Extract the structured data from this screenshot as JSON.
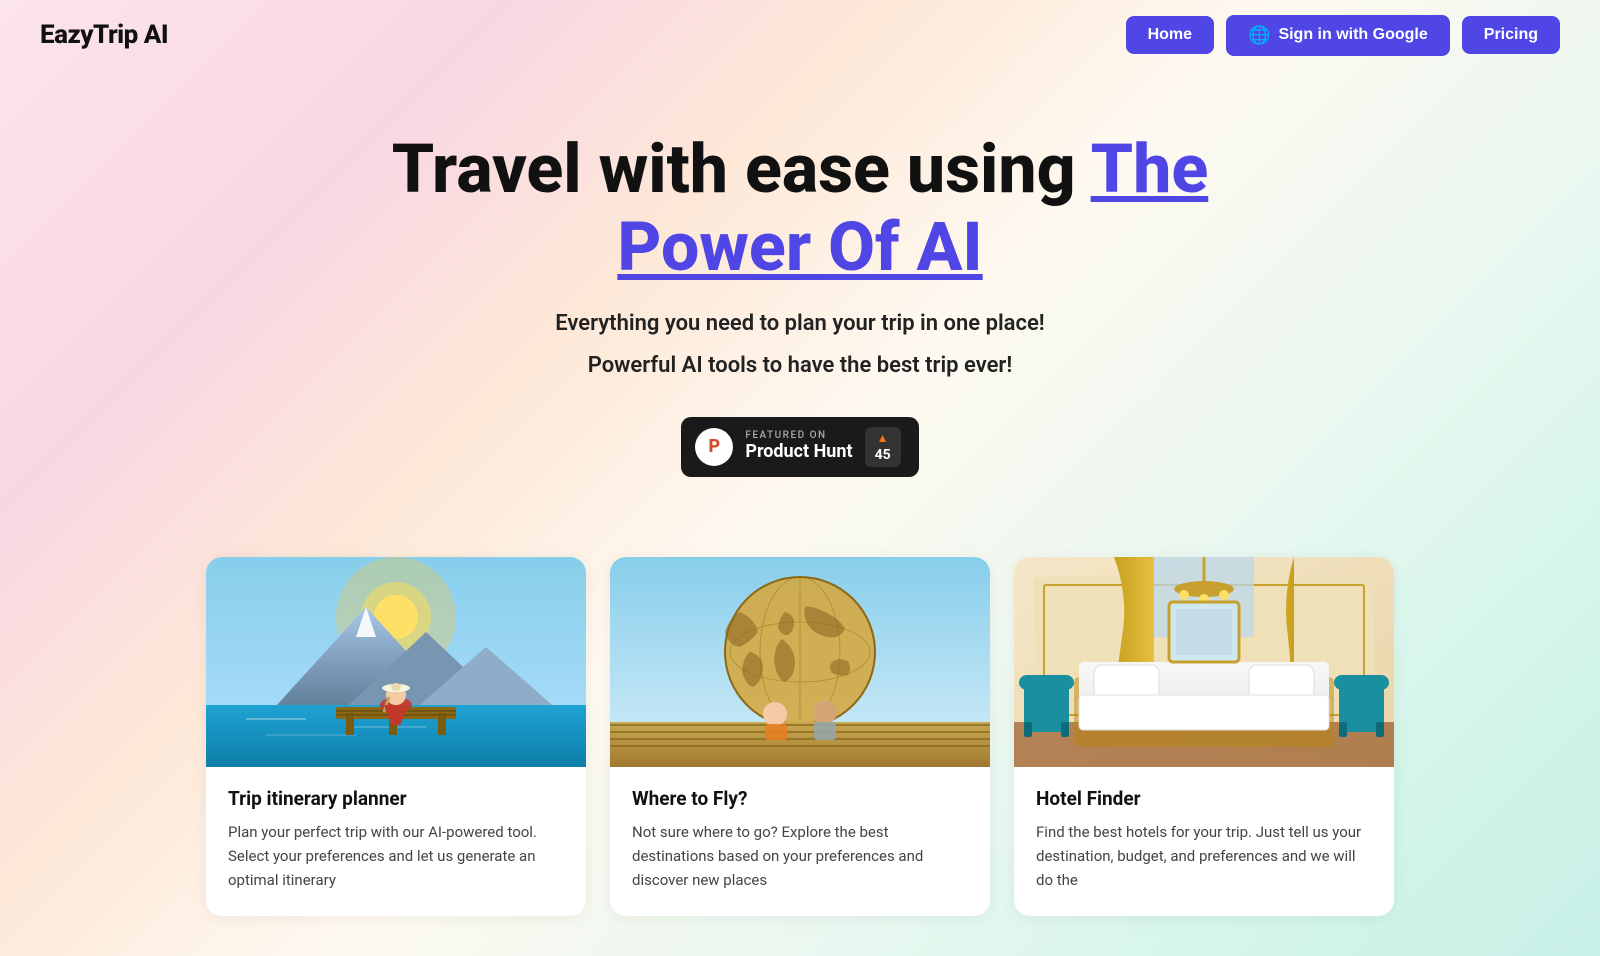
{
  "nav": {
    "logo": "EazyTrip AI",
    "home_label": "Home",
    "signin_label": "Sign in with Google",
    "signin_emoji": "🌐",
    "pricing_label": "Pricing"
  },
  "hero": {
    "title_part1": "Travel with ease using ",
    "title_link": "The Power Of AI",
    "subtitle1": "Everything you need to plan your trip in one place!",
    "subtitle2": "Powerful AI tools to have the best trip ever!"
  },
  "product_hunt": {
    "featured_label": "FEATURED ON",
    "name": "Product Hunt",
    "upvote_count": "45",
    "logo_letter": "P"
  },
  "cards": [
    {
      "id": "itinerary",
      "title": "Trip itinerary planner",
      "description": "Plan your perfect trip with our AI-powered tool. Select your preferences and let us generate an optimal itinerary",
      "img_alt": "Woman in red dress sitting on dock overlooking mountain lake",
      "img_theme": "lake"
    },
    {
      "id": "fly",
      "title": "Where to Fly?",
      "description": "Not sure where to go? Explore the best destinations based on your preferences and discover new places",
      "img_alt": "Couple sitting on dock looking at world map",
      "img_theme": "world"
    },
    {
      "id": "hotel",
      "title": "Hotel Finder",
      "description": "Find the best hotels for your trip. Just tell us your destination, budget, and preferences and we will do the",
      "img_alt": "Luxurious hotel room with teal chairs and golden curtains",
      "img_theme": "hotel"
    }
  ]
}
